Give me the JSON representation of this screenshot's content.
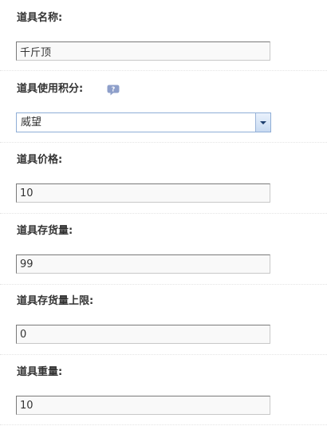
{
  "form": {
    "fields": [
      {
        "label": "道具名称:",
        "value": "千斤顶"
      },
      {
        "label": "道具使用积分:",
        "value": "威望",
        "type": "select",
        "help_icon": "question-bubble-icon"
      },
      {
        "label": "道具价格:",
        "value": "10"
      },
      {
        "label": "道具存货量:",
        "value": "99"
      },
      {
        "label": "道具存货量上限:",
        "value": "0"
      },
      {
        "label": "道具重量:",
        "value": "10"
      }
    ]
  },
  "colors": {
    "label_text": "#333333",
    "input_border": "#7a7a7a",
    "input_bg": "#f9f9f9",
    "select_border": "#8faed6",
    "help_icon": "#8e9fca"
  }
}
